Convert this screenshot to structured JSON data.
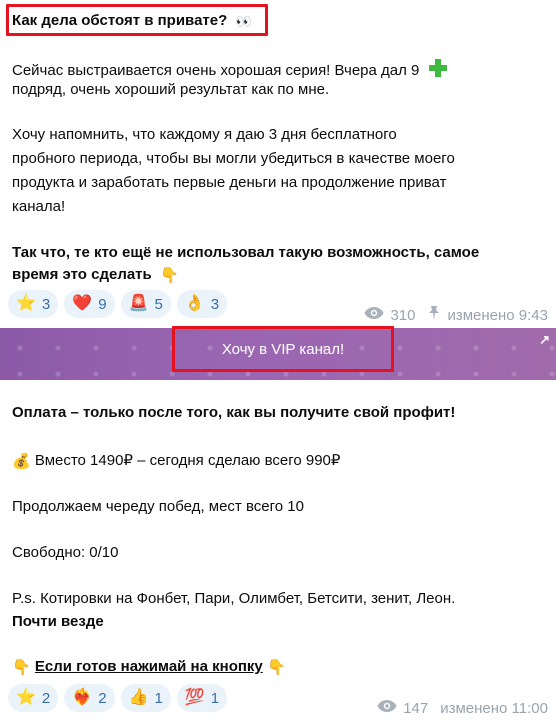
{
  "post1": {
    "title": "Как дела обстоят в привате?",
    "title_icon": "eyes-icon",
    "line1": "Сейчас выстраивается очень хорошая серия! Вчера дал 9",
    "line1_icon": "green-plus-icon",
    "line2": "подряд, очень хороший результат как по мне.",
    "para2": [
      "Хочу напомнить, что каждому я даю 3 дня бесплатного",
      "пробного периода, чтобы вы могли убедиться в качестве моего",
      "продукта и заработать первые деньги на продолжение приват",
      "канала!"
    ],
    "bold1": "Так что, те кто ещё не использовал такую возможность, самое",
    "bold2": "время это сделать",
    "bold2_icon": "pointing-down-hand-icon",
    "reactions": [
      {
        "emoji": "⭐",
        "icon": "star-icon",
        "count": "3"
      },
      {
        "emoji": "❤️",
        "icon": "heart-icon",
        "count": "9"
      },
      {
        "emoji": "🚨",
        "icon": "siren-icon",
        "count": "5"
      },
      {
        "emoji": "👌",
        "icon": "ok-hand-icon",
        "count": "3"
      }
    ],
    "views": "310",
    "edited": "изменено 9:43"
  },
  "vip_button": {
    "label": "Хочу в VIP канал!",
    "corner": "↗",
    "brand_color": "#9a66b2"
  },
  "post2": {
    "heading": "Оплата – только после того, как вы получите свой профит!",
    "price_icon": "money-bag-icon",
    "price": "Вместо 1490₽ – сегодня сделаю всего 990₽",
    "streak": "Продолжаем череду побед, мест всего 10",
    "free": "Свободно: 0/10",
    "ps1": "P.s. Котировки на Фонбет, Пари, Олимбет, Бетсити, зенит, Леон.",
    "ps2": "Почти везде",
    "cta": "Если готов нажимай на кнопку",
    "cta_icon": "pointing-down-hand-icon",
    "reactions": [
      {
        "emoji": "⭐",
        "icon": "star-icon",
        "count": "2"
      },
      {
        "emoji": "❤️‍🔥",
        "icon": "heart-fire-icon",
        "count": "2"
      },
      {
        "emoji": "👍",
        "icon": "thumbs-up-icon",
        "count": "1"
      },
      {
        "emoji": "💯",
        "icon": "hundred-icon",
        "count": "1"
      }
    ],
    "views": "147",
    "edited": "изменено 11:00"
  },
  "colors": {
    "highlight": "#e4131f",
    "reaction_bg": "#eaf2fa",
    "meta": "#9aa3ad"
  }
}
